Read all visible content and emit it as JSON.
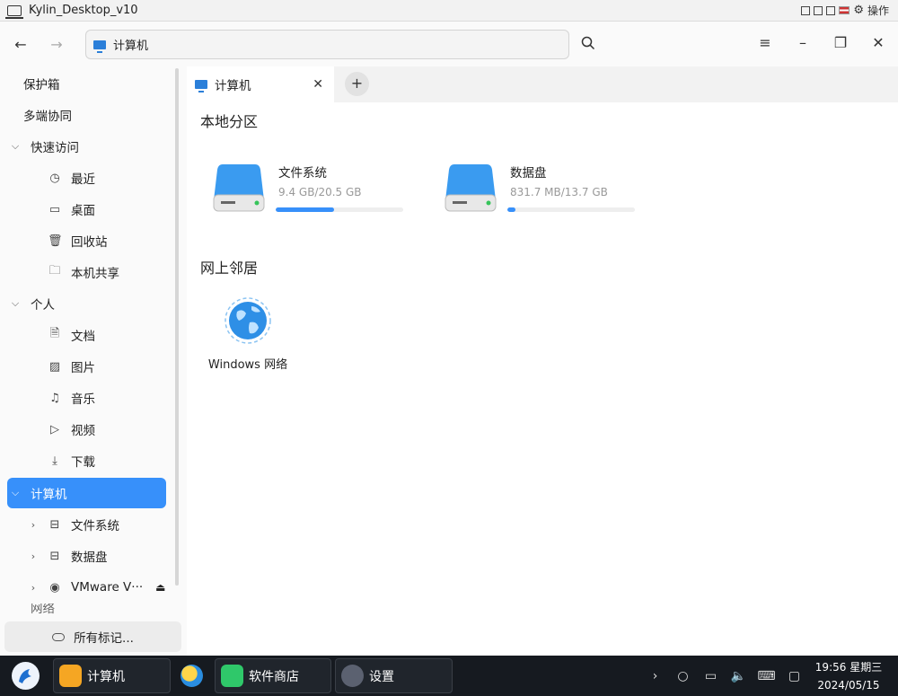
{
  "vm": {
    "title": "Kylin_Desktop_v10",
    "action_label": "操作"
  },
  "toolbar": {
    "back_icon": "←",
    "forward_icon": "→",
    "address": "计算机",
    "menu_icon": "≡",
    "minimize_icon": "–",
    "restore_icon": "❐",
    "close_icon": "✕"
  },
  "sidebar": {
    "vault": "保护箱",
    "multi_device": "多端协同",
    "quick_access": {
      "label": "快速访问",
      "items": [
        "最近",
        "桌面",
        "回收站",
        "本机共享"
      ]
    },
    "personal": {
      "label": "个人",
      "items": [
        "文档",
        "图片",
        "音乐",
        "视频",
        "下载"
      ]
    },
    "computer": {
      "label": "计算机",
      "items": [
        "文件系统",
        "数据盘",
        "VMware V···"
      ]
    },
    "network_partial": "网络",
    "all_tags": "所有标记..."
  },
  "tabs": [
    {
      "label": "计算机"
    }
  ],
  "main": {
    "local_title": "本地分区",
    "drives": [
      {
        "name": "文件系统",
        "usage": "9.4 GB/20.5 GB",
        "fraction": 0.46
      },
      {
        "name": "数据盘",
        "usage": "831.7 MB/13.7 GB",
        "fraction": 0.06
      }
    ],
    "network_title": "网上邻居",
    "network_items": [
      {
        "name": "Windows 网络"
      }
    ]
  },
  "taskbar": {
    "apps": [
      "计算机",
      "软件商店",
      "设置"
    ],
    "time": "19:56 星期三",
    "date": "2024/05/15"
  },
  "colors": {
    "accent": "#3790fa",
    "taskbar": "#161a20"
  }
}
